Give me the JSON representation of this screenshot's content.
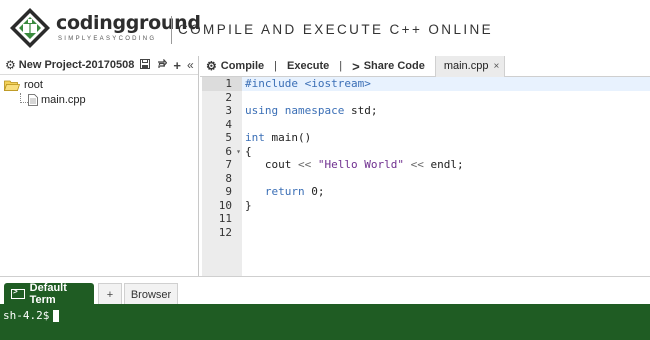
{
  "header": {
    "logo_name": "codingground",
    "logo_tagline": "SIMPLYEASYCODING",
    "title": "COMPILE AND EXECUTE C++ ONLINE"
  },
  "project": {
    "name": "New Project-20170508",
    "tools": [
      "save-icon",
      "refresh-icon",
      "add-icon",
      "collapse-icon"
    ],
    "tree": {
      "root_label": "root",
      "files": [
        {
          "label": "main.cpp"
        }
      ]
    }
  },
  "toolbar": {
    "compile_label": "Compile",
    "execute_label": "Execute",
    "share_label": "Share Code",
    "separator": "|",
    "active_file_tab": "main.cpp",
    "close_glyph": "×"
  },
  "editor": {
    "line_numbers": [
      "1",
      "2",
      "3",
      "4",
      "5",
      "6",
      "7",
      "8",
      "9",
      "10",
      "11",
      "12"
    ],
    "active_line": 1,
    "fold_line": 6,
    "code_lines": [
      "#include <iostream>",
      "",
      "using namespace std;",
      "",
      "int main()",
      "{",
      "   cout << \"Hello World\" << endl;",
      "",
      "   return 0;",
      "}",
      "",
      ""
    ]
  },
  "bottom_tabs": {
    "terminal_label": "Default Term",
    "plus_label": "+",
    "browser_label": "Browser"
  },
  "terminal": {
    "prompt": "sh-4.2$"
  },
  "colors": {
    "terminal_bg": "#1f5c23",
    "keyword": "#3b6fb6",
    "string": "#6f2f8f",
    "active_line": "#e8f2fe",
    "gutter_bg": "#ececec"
  }
}
